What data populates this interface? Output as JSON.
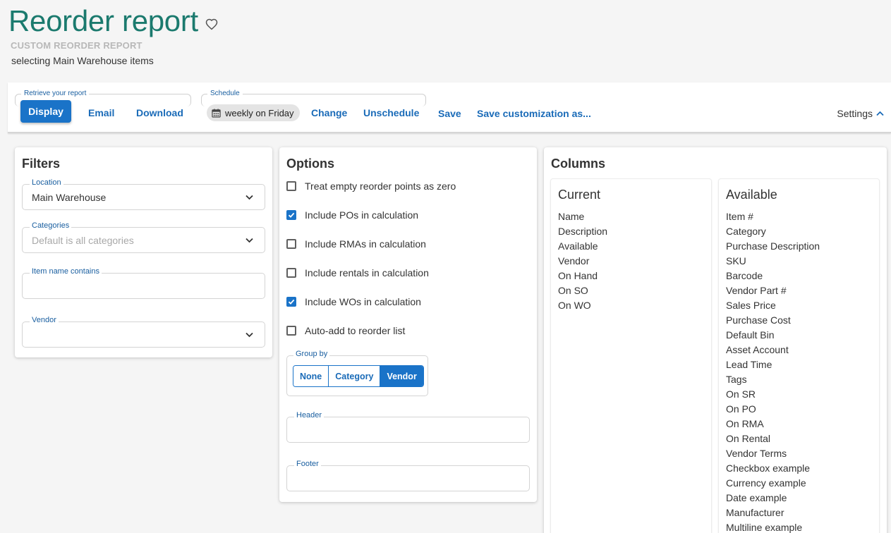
{
  "header": {
    "title": "Reorder report",
    "subtitle_caps": "CUSTOM REORDER REPORT",
    "description": "selecting Main Warehouse items"
  },
  "toolbar": {
    "retrieve_legend": "Retrieve your report",
    "schedule_legend": "Schedule",
    "display_label": "Display",
    "email_label": "Email",
    "download_label": "Download",
    "schedule_value": "weekly on Friday",
    "change_label": "Change",
    "unschedule_label": "Unschedule",
    "save_label": "Save",
    "save_custom_label": "Save customization as...",
    "settings_label": "Settings"
  },
  "filters": {
    "title": "Filters",
    "location": {
      "label": "Location",
      "value": "Main Warehouse"
    },
    "categories": {
      "label": "Categories",
      "placeholder": "Default is all categories"
    },
    "item_name": {
      "label": "Item name contains",
      "value": ""
    },
    "vendor": {
      "label": "Vendor",
      "value": ""
    }
  },
  "options": {
    "title": "Options",
    "items": [
      {
        "label": "Treat empty reorder points as zero",
        "checked": false
      },
      {
        "label": "Include POs in calculation",
        "checked": true
      },
      {
        "label": "Include RMAs in calculation",
        "checked": false
      },
      {
        "label": "Include rentals in calculation",
        "checked": false
      },
      {
        "label": "Include WOs in calculation",
        "checked": true
      },
      {
        "label": "Auto-add to reorder list",
        "checked": false
      }
    ],
    "group_by": {
      "label": "Group by",
      "choices": [
        "None",
        "Category",
        "Vendor"
      ],
      "selected": "Vendor"
    },
    "header_label": "Header",
    "footer_label": "Footer"
  },
  "columns": {
    "title": "Columns",
    "current": {
      "title": "Current",
      "items": [
        "Name",
        "Description",
        "Available",
        "Vendor",
        "On Hand",
        "On SO",
        "On WO"
      ]
    },
    "available": {
      "title": "Available",
      "items": [
        "Item #",
        "Category",
        "Purchase Description",
        "SKU",
        "Barcode",
        "Vendor Part #",
        "Sales Price",
        "Purchase Cost",
        "Default Bin",
        "Asset Account",
        "Lead Time",
        "Tags",
        "On SR",
        "On PO",
        "On RMA",
        "On Rental",
        "Vendor Terms",
        "Checkbox example",
        "Currency example",
        "Date example",
        "Manufacturer",
        "Multiline example"
      ]
    }
  },
  "colors": {
    "title": "#1b7a6e",
    "accent": "#1a73c8",
    "link": "#1a6bb8"
  }
}
